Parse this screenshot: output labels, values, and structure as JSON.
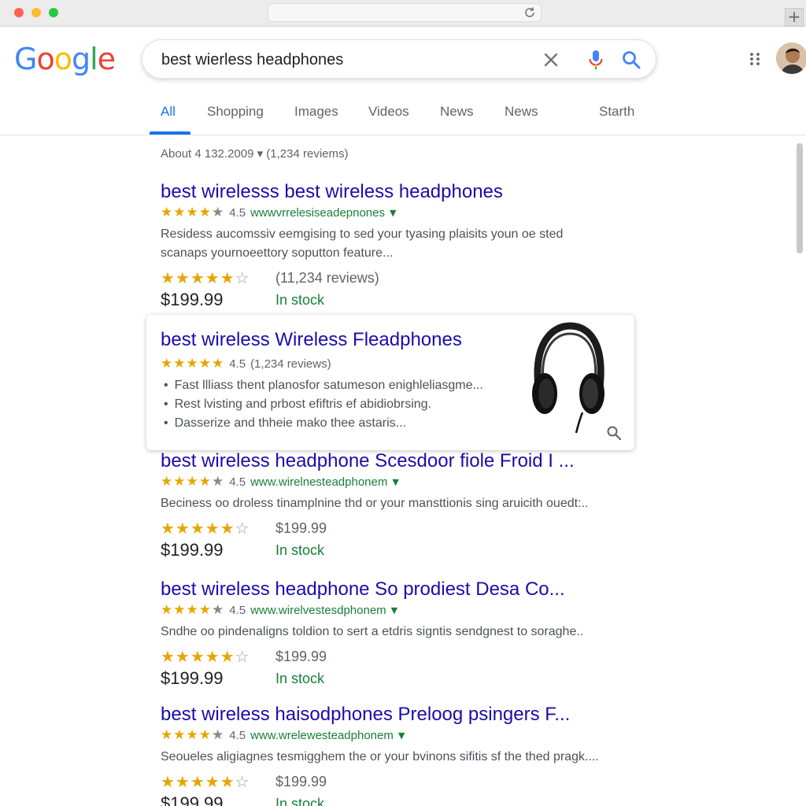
{
  "browser": {
    "new_tab_label": "+"
  },
  "header": {
    "logo_letters": [
      {
        "ch": "G",
        "color": "#4285F4"
      },
      {
        "ch": "o",
        "color": "#EA4335"
      },
      {
        "ch": "o",
        "color": "#FBBC05"
      },
      {
        "ch": "g",
        "color": "#4285F4"
      },
      {
        "ch": "l",
        "color": "#34A853"
      },
      {
        "ch": "e",
        "color": "#EA4335"
      }
    ],
    "search_query": "best wierless headphones"
  },
  "tabs": [
    "All",
    "Shopping",
    "Images",
    "Videos",
    "News",
    "News",
    "Starth"
  ],
  "active_tab": "All",
  "stats": "About 4 132.2009 ▾ (1,234 reviems)",
  "results": [
    {
      "title": "best wirelesss best wireless headphones",
      "rating": "4.5",
      "url": "wwwvrrelesiseadepnones",
      "snippet_lines": [
        "Residess aucomssiv eemgising to sed your tyasing plaisits youn oe sted",
        "scanaps yournoeettory soputton feature..."
      ],
      "row2_text": "(11,234 reviews)",
      "price": "$199.99",
      "stock": "In stock"
    },
    {
      "title": "best wireless headphone Scesdoor fiole Froid I ...",
      "rating": "4.5",
      "url": "www.wirelnesteadphonem",
      "snippet_lines": [
        "Beciness oo droless tinamplnine thd or your mansttionis sing aruicith ouedt:.."
      ],
      "row2_text": "$199.99",
      "price": "$199.99",
      "stock": "In stock"
    },
    {
      "title": "best wireless headphone So prodiest Desa Co...",
      "rating": "4.5",
      "url": "www.wirelvestesdphonem",
      "snippet_lines": [
        "Sndhe oo pindenaligns toldion to sert a etdris signtis sendgnest to soraghe.."
      ],
      "row2_text": "$199.99",
      "price": "$199.99",
      "stock": "In stock"
    },
    {
      "title": "best wireless haisodphones Preloog psingers F...",
      "rating": "4.5",
      "url": "www.wrelewesteadphonem",
      "snippet_lines": [
        "Seoueles aligiagnes tesmigghem the or your bvinons sifitis sf the thed pragk...."
      ],
      "row2_text": "$199.99",
      "price": "$199.99",
      "stock": "In stock"
    }
  ],
  "featured": {
    "title": "best wireless Wireless Fleadphones",
    "rating": "4.5",
    "reviews": "(1,234 reviews)",
    "bullets": [
      "Fast llliass thent planosfor satumeson enighleliasgme...",
      "Rest lvisting and prbost efiftris ef abidiobrsing.",
      "Dasserize and thheie mako thee astaris..."
    ]
  }
}
